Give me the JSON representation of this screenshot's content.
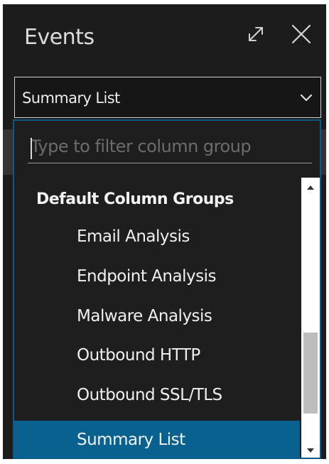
{
  "panel": {
    "title": "Events"
  },
  "column_group_select": {
    "value": "Summary List"
  },
  "filter": {
    "placeholder": "Type to filter column group",
    "value": ""
  },
  "list": {
    "group_header": "Default Column Groups",
    "items": [
      {
        "label": "Email Analysis",
        "selected": false
      },
      {
        "label": "Endpoint Analysis",
        "selected": false
      },
      {
        "label": "Malware Analysis",
        "selected": false
      },
      {
        "label": "Outbound HTTP",
        "selected": false
      },
      {
        "label": "Outbound SSL/TLS",
        "selected": false
      },
      {
        "label": "Summary List",
        "selected": true
      }
    ]
  },
  "icons": {
    "expand": "expand-icon",
    "close": "close-icon",
    "dropdown": "chevron-down-icon",
    "scroll_up": "arrow-up-icon",
    "scroll_down": "arrow-down-icon"
  },
  "colors": {
    "panel_background": "#1c1c1c",
    "accent_border": "#0c5a87",
    "selected_row": "#08618f"
  }
}
